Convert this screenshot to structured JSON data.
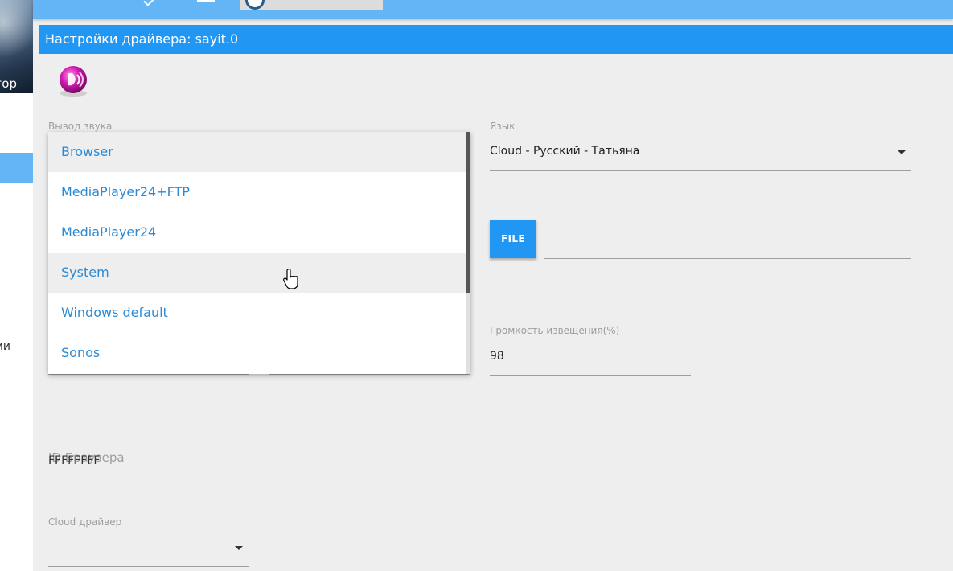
{
  "sidebar": {
    "title": "гор",
    "item_tail": "ии"
  },
  "page": {
    "title": "Настройки драйвера: sayit.0"
  },
  "fields": {
    "sound_output": {
      "label": "Вывод звука"
    },
    "language": {
      "label": "Язык",
      "value": "Cloud - Русский - Татьяна"
    },
    "file_button": {
      "label": "FILE"
    },
    "volume": {
      "label": "Громкость извещения(%)",
      "value": "98"
    },
    "browser_id": {
      "label": "ID Браузера",
      "value": "FFFFFFFF"
    },
    "cloud_driver": {
      "label": "Cloud драйвер",
      "value": ""
    }
  },
  "dropdown": {
    "options": [
      {
        "label": "Browser",
        "highlighted": true
      },
      {
        "label": "MediaPlayer24+FTP",
        "highlighted": false
      },
      {
        "label": "MediaPlayer24",
        "highlighted": false
      },
      {
        "label": "System",
        "highlighted": true
      },
      {
        "label": "Windows default",
        "highlighted": false
      },
      {
        "label": "Sonos",
        "highlighted": false
      }
    ]
  },
  "colors": {
    "primary": "#2196f3",
    "toolbar": "#64b5f6",
    "link": "#2a8ad6",
    "background": "#eeeeee"
  },
  "icons": {
    "logo": "sayit-speaker-icon",
    "cursor": "hand-pointer-icon"
  }
}
